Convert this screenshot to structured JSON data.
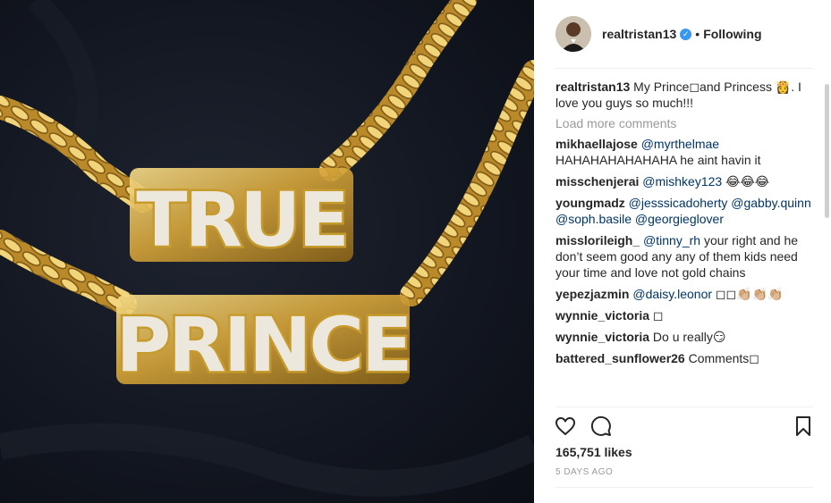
{
  "post": {
    "image_alt": "Gold chain necklaces with TRUE and PRINCE nameplates",
    "plate_top": "TRUE",
    "plate_bottom": "PRINCE"
  },
  "header": {
    "username": "realtristan13",
    "verified_icon": "✓",
    "dot": "•",
    "follow_status": "Following"
  },
  "caption": {
    "user": "realtristan13",
    "text": "My Prince◻and Princess 👸. I love you guys so much!!!"
  },
  "load_more": "Load more comments",
  "comments": [
    {
      "user": "mikhaellajose",
      "mention": "@myrthelmae",
      "text": " HAHAHAHAHAHAHA he aint havin it"
    },
    {
      "user": "misschenjerai",
      "mention": "@mishkey123",
      "text": " 😂😂😂"
    },
    {
      "user": "youngmadz",
      "mention": "@jesssicadoherty @gabby.quinn @soph.basile @georgieglover",
      "text": ""
    },
    {
      "user": "misslorileigh_",
      "mention": "@tinny_rh",
      "text": " your right and he don’t seem good any any of them kids need your time and love not gold chains"
    },
    {
      "user": "yepezjazmin",
      "mention": "@daisy.leonor",
      "text": " ◻◻👏🏼👏🏼👏🏼"
    },
    {
      "user": "wynnie_victoria",
      "mention": "",
      "text": " ◻"
    },
    {
      "user": "wynnie_victoria",
      "mention": "",
      "text": " Do u really😏"
    },
    {
      "user": "battered_sunflower26",
      "mention": "",
      "text": " Comments◻"
    }
  ],
  "likes": "165,751 likes",
  "timestamp": "5 DAYS AGO",
  "icons": {
    "like": "heart-icon",
    "comment": "comment-icon",
    "save": "bookmark-icon"
  },
  "colors": {
    "mention": "#003569",
    "verified": "#3897f0",
    "muted": "#999999",
    "gold": "#c79a2c"
  }
}
